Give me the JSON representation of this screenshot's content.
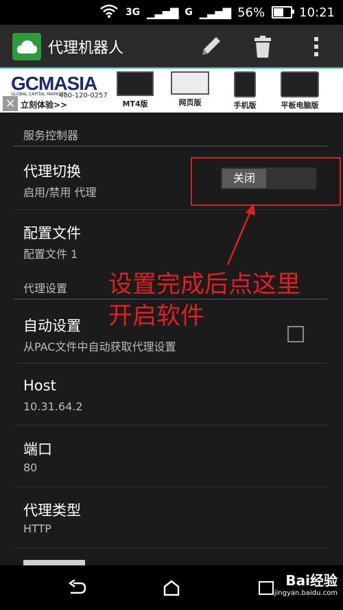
{
  "status": {
    "network_3g": "3G",
    "network_g": "G",
    "battery": "56%",
    "time": "10:21"
  },
  "app": {
    "title": "代理机器人"
  },
  "ad": {
    "logo": "GCMASIA",
    "subtitle": "GLOBAL CAPITAL MARKETS",
    "phone": "400-120-0257",
    "cta": "立刻体验>>",
    "products": [
      "MT4版",
      "网页版",
      "手机版",
      "平板电脑版"
    ],
    "close": "×"
  },
  "settings": {
    "service_header": "服务控制器",
    "proxy_switch": {
      "title": "代理切换",
      "summary": "启用/禁用 代理",
      "toggle": "关闭"
    },
    "profile": {
      "title": "配置文件",
      "summary": "配置文件 1"
    },
    "proxy_header": "代理设置",
    "auto": {
      "title": "自动设置",
      "summary": "从PAC文件中自动获取代理设置",
      "checked": false
    },
    "host": {
      "title": "Host",
      "summary": "10.31.64.2"
    },
    "port": {
      "title": "端口",
      "summary": "80"
    },
    "type": {
      "title": "代理类型",
      "summary": "HTTP"
    }
  },
  "annotation": {
    "line1": "设置完成后点这里",
    "line2": "开启软件"
  },
  "watermark": {
    "brand": "Bai经验",
    "url": "jingyan.baidu.com"
  },
  "colors": {
    "accent": "#33b5e5",
    "annotation": "#e02020",
    "app_icon": "#2e9a3e"
  }
}
